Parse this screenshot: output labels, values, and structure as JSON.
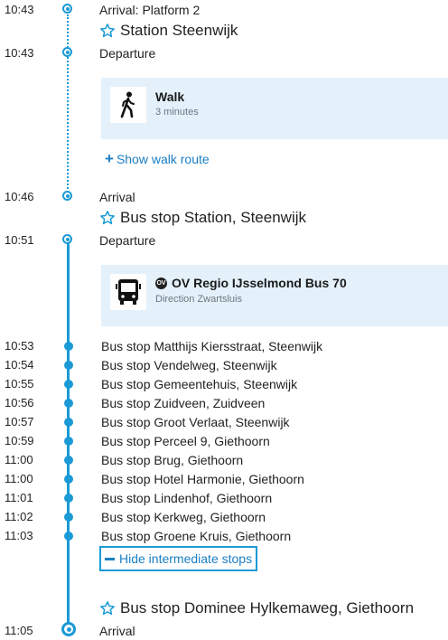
{
  "colors": {
    "accent": "#1b9ad6",
    "link": "#1b7fc4",
    "card_bg": "#e4f1fa"
  },
  "segments": {
    "arrival1": {
      "time": "10:43",
      "label": "Arrival: Platform 2"
    },
    "station1": {
      "name": "Station Steenwijk",
      "icon": "star-icon"
    },
    "departure1": {
      "time": "10:43",
      "label": "Departure"
    },
    "walk_card": {
      "title": "Walk",
      "subtitle": "3 minutes",
      "icon": "walking-person-icon"
    },
    "show_walk_route": "Show walk route",
    "arrival2": {
      "time": "10:46",
      "label": "Arrival"
    },
    "station2": {
      "name": "Bus stop Station, Steenwijk",
      "icon": "star-icon"
    },
    "departure2": {
      "time": "10:51",
      "label": "Departure"
    },
    "bus_card": {
      "badge": "OV",
      "title": "OV Regio IJsselmond Bus 70",
      "subtitle": "Direction Zwartsluis",
      "icon": "bus-icon"
    },
    "intermediate_stops": [
      {
        "time": "10:53",
        "name": "Bus stop Matthijs Kiersstraat, Steenwijk"
      },
      {
        "time": "10:54",
        "name": "Bus stop Vendelweg, Steenwijk"
      },
      {
        "time": "10:55",
        "name": "Bus stop Gemeentehuis, Steenwijk"
      },
      {
        "time": "10:56",
        "name": "Bus stop Zuidveen, Zuidveen"
      },
      {
        "time": "10:57",
        "name": "Bus stop Groot Verlaat, Steenwijk"
      },
      {
        "time": "10:59",
        "name": "Bus stop Perceel 9, Giethoorn"
      },
      {
        "time": "11:00",
        "name": "Bus stop Brug, Giethoorn"
      },
      {
        "time": "11:00",
        "name": "Bus stop Hotel Harmonie, Giethoorn"
      },
      {
        "time": "11:01",
        "name": "Bus stop Lindenhof, Giethoorn"
      },
      {
        "time": "11:02",
        "name": "Bus stop Kerkweg, Giethoorn"
      },
      {
        "time": "11:03",
        "name": "Bus stop Groene Kruis, Giethoorn"
      }
    ],
    "hide_intermediate": "Hide intermediate stops",
    "station3": {
      "name": "Bus stop Dominee Hylkemaweg, Giethoorn",
      "icon": "star-icon"
    },
    "arrival3": {
      "time": "11:05",
      "label": "Arrival"
    }
  }
}
